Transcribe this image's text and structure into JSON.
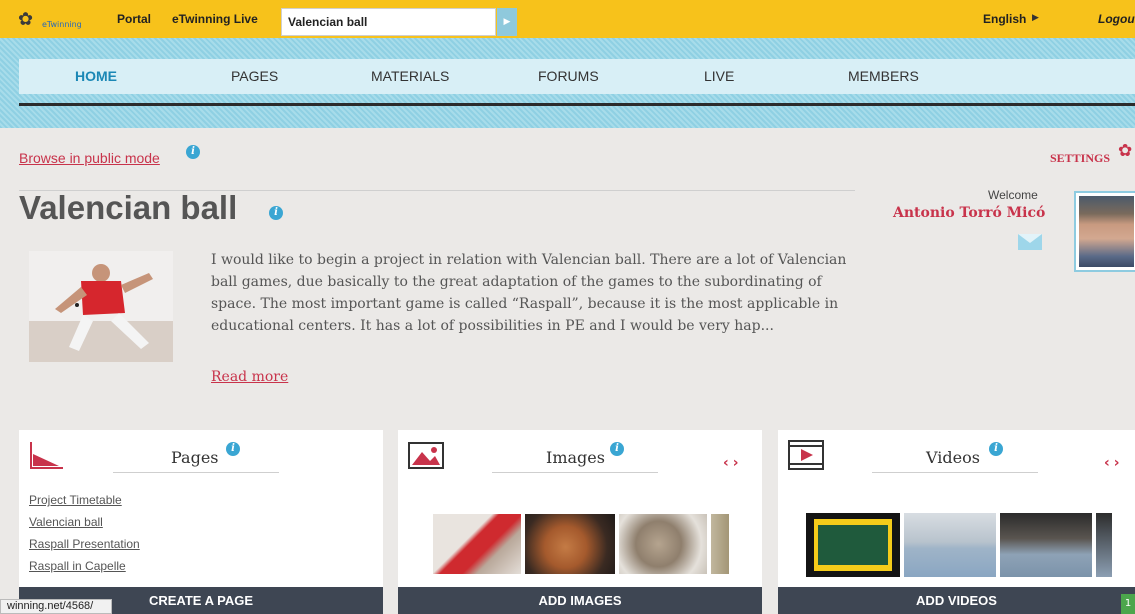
{
  "topbar": {
    "logo_text": "eTwinning",
    "links": [
      "Portal",
      "eTwinning Live"
    ],
    "search_value": "Valencian ball",
    "language": "English",
    "logout": "Logout"
  },
  "nav": {
    "items": [
      "HOME",
      "PAGES",
      "MATERIALS",
      "FORUMS",
      "LIVE",
      "MEMBERS"
    ],
    "active": "HOME"
  },
  "browse_public": "Browse in public mode",
  "settings_label": "SETTINGS",
  "project": {
    "title": "Valencian ball",
    "description": "I would like to begin a project in relation with Valencian ball. There are a lot of Valencian ball games, due basically to the great adaptation of the games to the subordinating of space. The most important game is called “Raspall”, because it is the most applicable in educational centers. It has a lot of possibilities in PE and I would be very hap...",
    "read_more": "Read more"
  },
  "user": {
    "welcome": "Welcome",
    "name": "Antonio Torró Micó"
  },
  "cards": {
    "pages": {
      "title": "Pages",
      "links": [
        "Project Timetable",
        "Valencian ball",
        "Raspall Presentation",
        "Raspall in Capelle"
      ],
      "button": "CREATE A PAGE"
    },
    "images": {
      "title": "Images",
      "button": "ADD IMAGES"
    },
    "videos": {
      "title": "Videos",
      "button": "ADD VIDEOS"
    }
  },
  "statusbar": "winning.net/4568/",
  "corner_badge": "1",
  "icons": {
    "info": "info-icon",
    "settings": "gear-icon",
    "mail": "mail-icon",
    "search_go": "play-arrow-icon"
  },
  "colors": {
    "topbar": "#f7c21b",
    "accent_red": "#c8334b",
    "nav_blue": "#1a87b5",
    "button_dark": "#3e4653"
  }
}
